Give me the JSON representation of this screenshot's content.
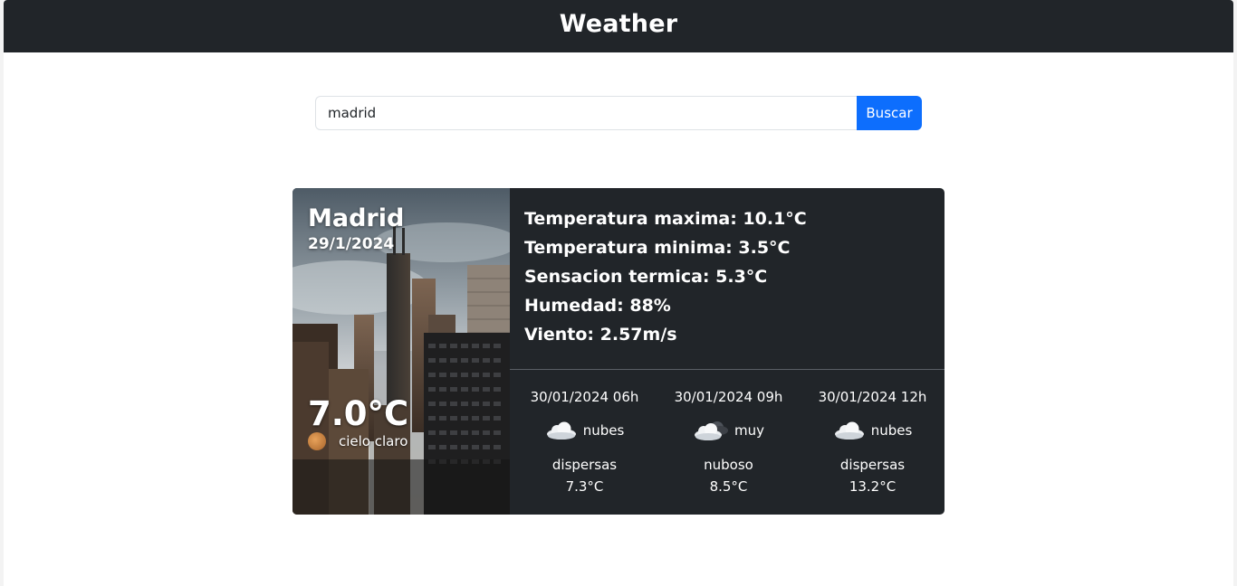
{
  "header": {
    "title": "Weather"
  },
  "search": {
    "value": "madrid",
    "button_label": "Buscar"
  },
  "current": {
    "city": "Madrid",
    "date": "29/1/2024",
    "temperature": "7.0°C",
    "condition": "cielo claro",
    "details": [
      "Temperatura maxima: 10.1°C",
      "Temperatura minima: 3.5°C",
      "Sensacion termica: 5.3°C",
      "Humedad: 88%",
      "Viento: 2.57m/s"
    ]
  },
  "forecast": [
    {
      "time": "30/01/2024 06h",
      "icon": "scattered-clouds-icon",
      "desc_1": "nubes",
      "desc_2": "dispersas",
      "temp": "7.3°C"
    },
    {
      "time": "30/01/2024 09h",
      "icon": "broken-clouds-icon",
      "desc_1": "muy",
      "desc_2": "nuboso",
      "temp": "8.5°C"
    },
    {
      "time": "30/01/2024 12h",
      "icon": "scattered-clouds-icon",
      "desc_1": "nubes",
      "desc_2": "dispersas",
      "temp": "13.2°C"
    }
  ],
  "colors": {
    "navbar": "#212529",
    "card": "#212529",
    "accent": "#0d6efd"
  }
}
